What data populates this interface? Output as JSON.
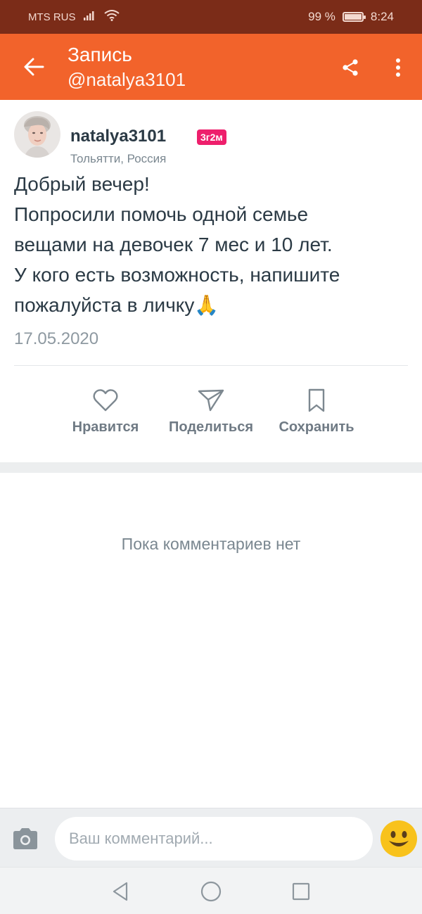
{
  "status_bar": {
    "carrier": "MTS RUS",
    "battery": "99 %",
    "time": "8:24",
    "battery_level": 0.99
  },
  "app_bar": {
    "title": "Запись",
    "subtitle": "@natalya3101",
    "back_icon": "arrow-left-icon",
    "share_icon": "share-icon",
    "more_icon": "more-vertical-icon"
  },
  "post": {
    "author_name": "natalya3101",
    "age_badge": "3г2м",
    "location": "Тольятти, Россия",
    "text_lines": [
      "Добрый вечер!",
      "Попросили помочь одной семье",
      "вещами на девочек 7 мес и 10 лет.",
      "У кого есть возможность, напишите",
      "пожалуйста в личку🙏"
    ],
    "date": "17.05.2020"
  },
  "actions": {
    "like_label": "Нравится",
    "share_label": "Поделиться",
    "save_label": "Сохранить"
  },
  "comments": {
    "empty_text": "Пока комментариев нет"
  },
  "comment_bar": {
    "placeholder": "Ваш комментарий..."
  },
  "colors": {
    "status_bar": "#7b2c18",
    "app_bar": "#f2632b",
    "badge": "#ee1f6c",
    "text": "#2b3a45",
    "muted": "#7a8790"
  }
}
